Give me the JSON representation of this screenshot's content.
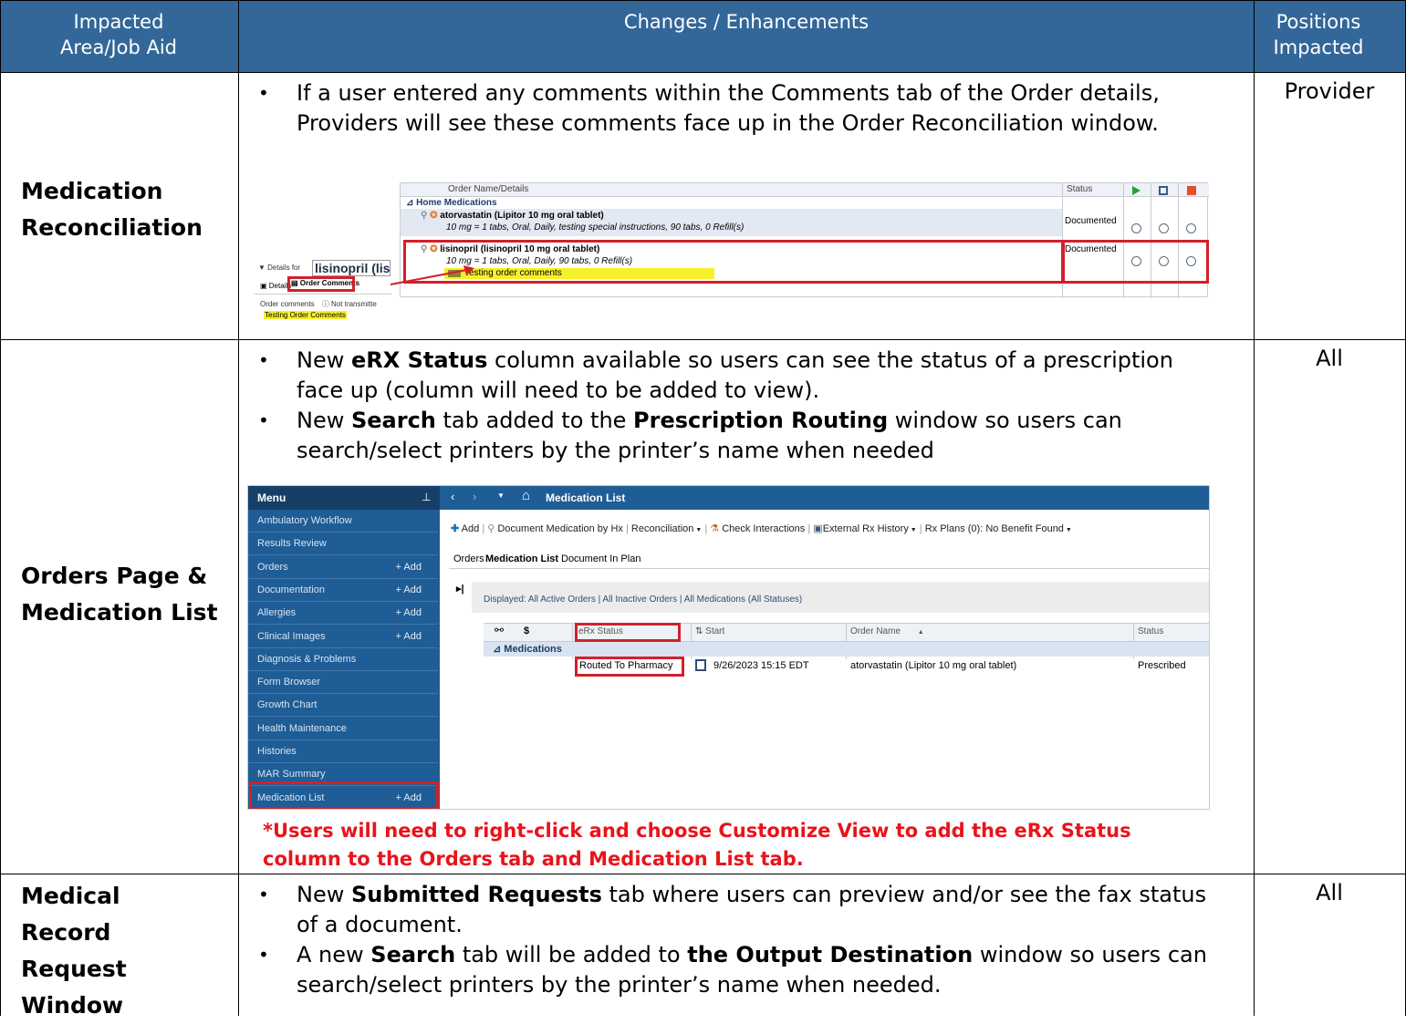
{
  "header": {
    "col1": "Impacted Area/Job Aid",
    "col2": "Changes / Enhancements",
    "col3": "Positions Impacted"
  },
  "rows": [
    {
      "area": "Medication Reconciliation",
      "positions": "Provider",
      "bullets": [
        {
          "text": "If a user entered any comments within the Comments tab of the Order details, Providers will see these comments face up in the Order Reconciliation window."
        }
      ],
      "screenshot": {
        "col_order_name": "Order Name/Details",
        "col_status": "Status",
        "group": "Home Medications",
        "meds": [
          {
            "name": "atorvastatin (Lipitor 10 mg oral tablet)",
            "detail": "10 mg = 1 tabs, Oral, Daily, testing special instructions, 90 tabs, 0 Refill(s)",
            "status": "Documented"
          },
          {
            "name": "lisinopril (lisinopril 10 mg oral tablet)",
            "detail": "10 mg = 1 tabs, Oral, Daily, 90 tabs, 0 Refill(s)",
            "comment": "Testing order comments",
            "status": "Documented"
          }
        ],
        "details_for_label": "Details for",
        "details_for_name": "lisinopril (lisir",
        "tab_details": "Details",
        "tab_order_comments": "Order Comments",
        "order_comments_label": "Order comments",
        "not_transmitted": "Not transmitte",
        "comment_value": "Testing Order Comments"
      }
    },
    {
      "area": "Orders Page & Medication List",
      "positions": "All",
      "bullets": [
        {
          "pre": "New ",
          "bold": "eRX Status",
          "post": " column available so users can see the status of a prescription face up (column will need to be added to view)."
        },
        {
          "pre": "New ",
          "bold": "Search",
          "mid": " tab added to the ",
          "bold2": "Prescription Routing",
          "post": " window so users can search/select printers by the printer’s name when needed"
        }
      ],
      "screenshot": {
        "menu_title": "Menu",
        "menu_items": [
          {
            "label": "Ambulatory Workflow",
            "add": ""
          },
          {
            "label": "Results Review",
            "add": ""
          },
          {
            "label": "Orders",
            "add": "+ Add"
          },
          {
            "label": "Documentation",
            "add": "+ Add"
          },
          {
            "label": "Allergies",
            "add": "+ Add"
          },
          {
            "label": "Clinical Images",
            "add": "+ Add"
          },
          {
            "label": "Diagnosis & Problems",
            "add": ""
          },
          {
            "label": "Form Browser",
            "add": ""
          },
          {
            "label": "Growth Chart",
            "add": ""
          },
          {
            "label": "Health Maintenance",
            "add": ""
          },
          {
            "label": "Histories",
            "add": ""
          },
          {
            "label": "MAR Summary",
            "add": ""
          },
          {
            "label": "Medication List",
            "add": "+ Add"
          }
        ],
        "page_title": "Medication List",
        "toolbar": {
          "add": "Add",
          "doc_med": "Document Medication by Hx",
          "reconciliation": "Reconciliation",
          "check_interactions": "Check Interactions",
          "external_rx": "External Rx History",
          "rx_plans": "Rx Plans (0): No Benefit Found"
        },
        "tabs": [
          "Orders",
          "Medication List",
          "Document In Plan"
        ],
        "displayed": "Displayed: All Active Orders | All Inactive Orders | All Medications (All Statuses)",
        "columns": {
          "dollar": "$",
          "erx": "eRx Status",
          "start": "Start",
          "order_name": "Order Name",
          "status": "Status"
        },
        "group": "Medications",
        "row": {
          "erx": "Routed To Pharmacy",
          "start": "9/26/2023 15:15 EDT",
          "order_name": "atorvastatin (Lipitor 10 mg oral tablet)",
          "status": "Prescribed"
        }
      },
      "note": "*Users will need to right-click and choose Customize View to add the eRx Status column to the Orders tab and Medication List tab."
    },
    {
      "area": "Medical Record Request Window",
      "positions": "All",
      "bullets": [
        {
          "pre": "New ",
          "bold": "Submitted Requests",
          "post": " tab where users can preview and/or see the fax status of a document."
        },
        {
          "pre": "A new ",
          "bold": "Search",
          "mid": " tab will be added to ",
          "bold2": "the Output Destination",
          "post": " window so users can search/select printers by the printer’s name when needed."
        }
      ]
    }
  ],
  "colors": {
    "header_bg": "#336799",
    "menu_bg": "#1f5d96",
    "note_red": "#e8141b",
    "highlight_box": "#d2202a"
  }
}
